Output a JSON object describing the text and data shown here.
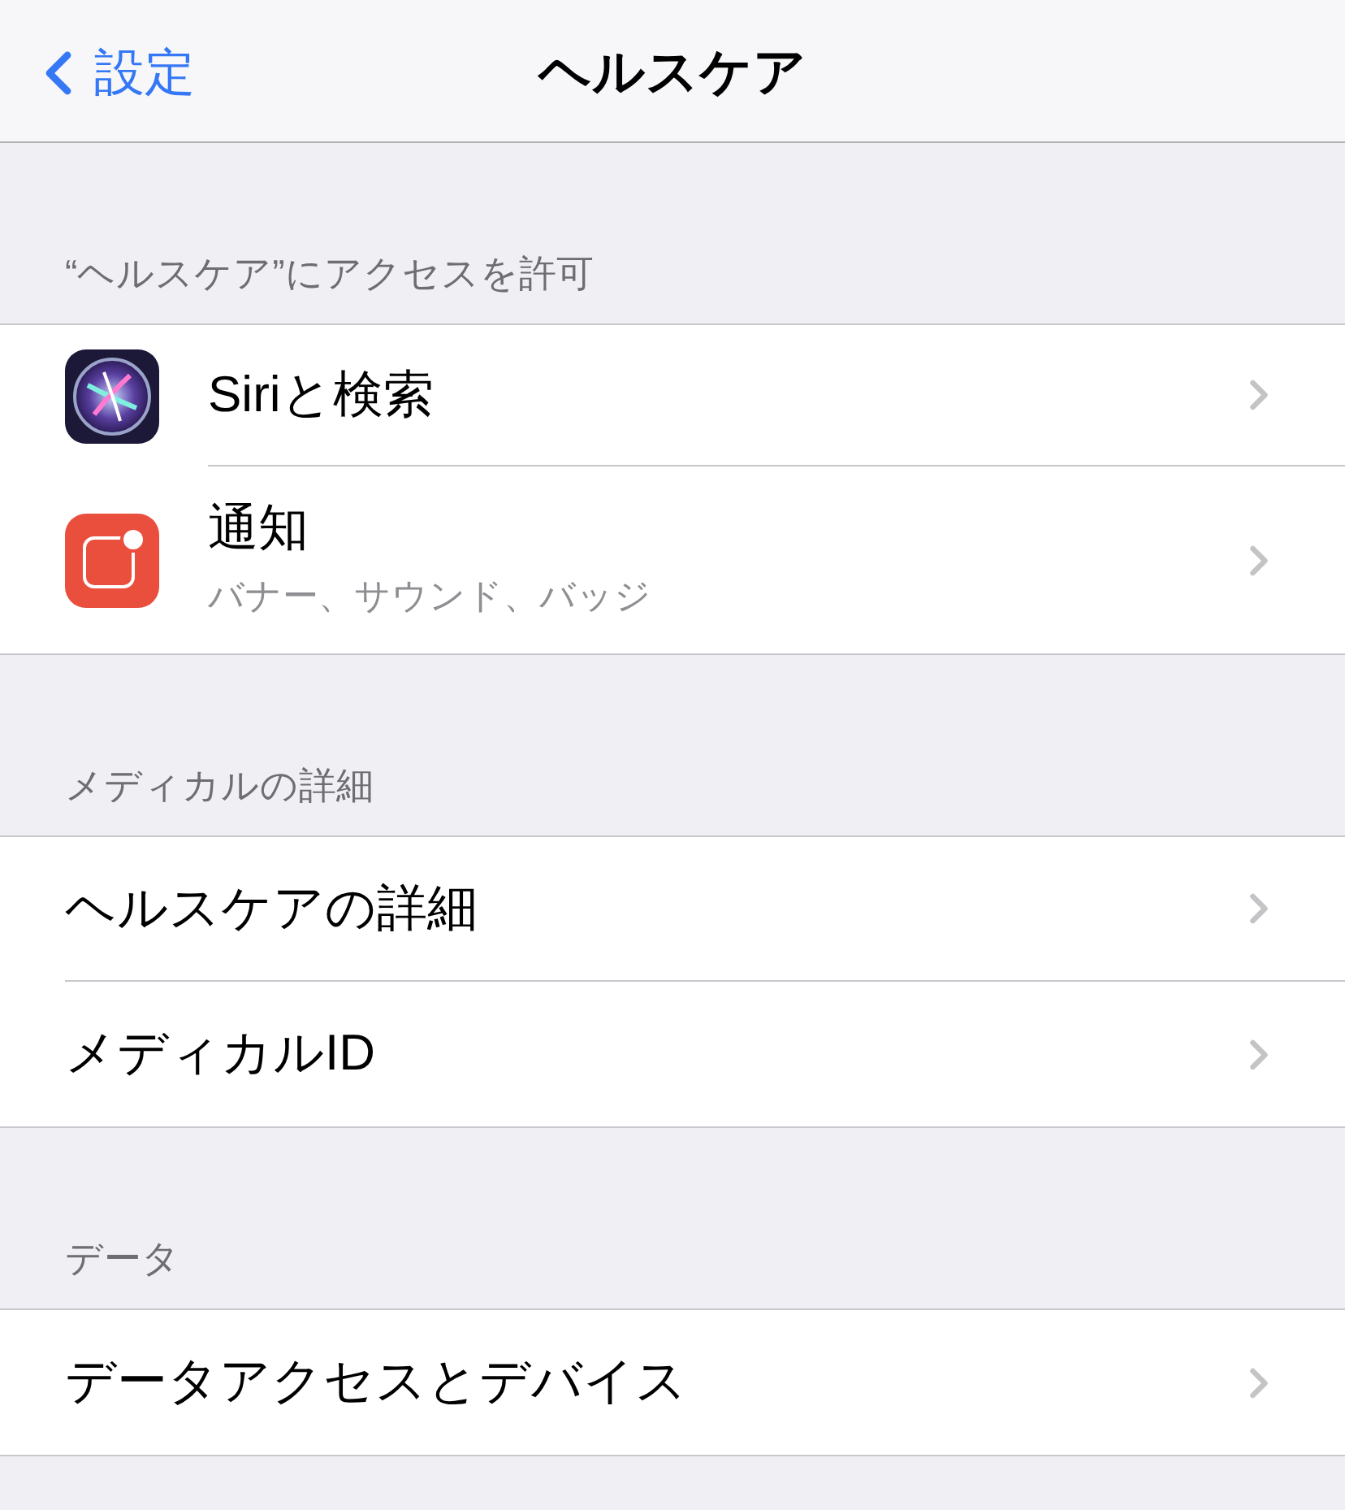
{
  "nav": {
    "back": "設定",
    "title": "ヘルスケア"
  },
  "sections": [
    {
      "header": "“ヘルスケア”にアクセスを許可",
      "rows": [
        {
          "kind": "siri",
          "title": "Siriと検索"
        },
        {
          "kind": "notifications",
          "title": "通知",
          "subtitle": "バナー、サウンド、バッジ"
        }
      ]
    },
    {
      "header": "メディカルの詳細",
      "rows": [
        {
          "kind": "plain",
          "title": "ヘルスケアの詳細"
        },
        {
          "kind": "plain",
          "title": "メディカルID"
        }
      ]
    },
    {
      "header": "データ",
      "rows": [
        {
          "kind": "plain",
          "title": "データアクセスとデバイス"
        }
      ]
    }
  ]
}
